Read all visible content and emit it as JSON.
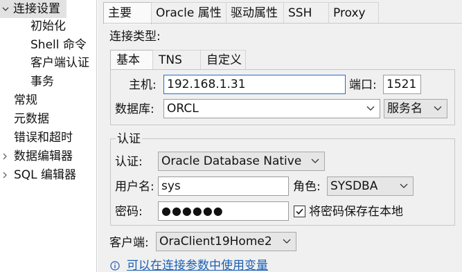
{
  "nav": {
    "items": [
      {
        "label": "连接设置",
        "expanded": true,
        "selected": true
      },
      {
        "label": "初始化"
      },
      {
        "label": "Shell 命令"
      },
      {
        "label": "客户端认证"
      },
      {
        "label": "事务"
      },
      {
        "label": "常规"
      },
      {
        "label": "元数据"
      },
      {
        "label": "错误和超时"
      },
      {
        "label": "数据编辑器",
        "expandable": true
      },
      {
        "label": "SQL 编辑器",
        "expandable": true
      }
    ]
  },
  "tabs": [
    {
      "label": "主要",
      "active": true
    },
    {
      "label": "Oracle 属性"
    },
    {
      "label": "驱动属性"
    },
    {
      "label": "SSH"
    },
    {
      "label": "Proxy"
    }
  ],
  "connection_type": {
    "label": "连接类型:",
    "tabs": [
      {
        "label": "基本",
        "active": true
      },
      {
        "label": "TNS"
      },
      {
        "label": "自定义"
      }
    ]
  },
  "host": {
    "label": "主机:",
    "value": "192.168.1.31"
  },
  "port": {
    "label": "端口:",
    "value": "1521"
  },
  "database": {
    "label": "数据库:",
    "value": "ORCL",
    "type_value": "服务名"
  },
  "auth_group": {
    "title": "认证",
    "auth": {
      "label": "认证:",
      "value": "Oracle Database Native"
    },
    "username": {
      "label": "用户名:",
      "value": "sys"
    },
    "role": {
      "label": "角色:",
      "value": "SYSDBA"
    },
    "password": {
      "label": "密码:",
      "value": "●●●●●●"
    },
    "save_password": {
      "label": "将密码保存在本地",
      "checked": true
    }
  },
  "client": {
    "label": "客户端:",
    "value": "OraClient19Home2"
  },
  "vars_link": {
    "label": "可以在连接参数中使用变量"
  }
}
